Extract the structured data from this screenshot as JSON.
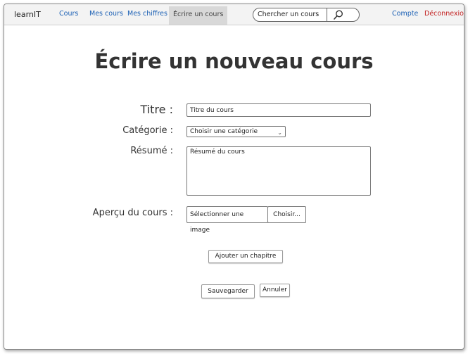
{
  "app": {
    "logo": "learnIT"
  },
  "nav": {
    "items": [
      {
        "label": "Cours"
      },
      {
        "label": "Mes cours"
      },
      {
        "label": "Mes chiffres"
      },
      {
        "label": "Écrire un cours"
      }
    ],
    "active_index": 3
  },
  "search": {
    "value": "Chercher un cours",
    "icon": "search-icon"
  },
  "user_links": {
    "account": "Compte",
    "logout": "Déconnexion"
  },
  "page": {
    "title": "Écrire un nouveau cours"
  },
  "form": {
    "title_label": "Titre :",
    "title_value": "Titre du cours",
    "category_label": "Catégorie :",
    "category_value": "Choisir une catégorie",
    "summary_label": "Résumé :",
    "summary_value": "Résumé du cours",
    "preview_label": "Aperçu du cours :",
    "preview_value": "Sélectionner une image",
    "browse_label": "Choisir...",
    "add_chapter_label": "Ajouter un chapitre",
    "save_label": "Sauvegarder",
    "cancel_label": "Annuler"
  },
  "colors": {
    "link": "#1a5fb4",
    "logout": "#c21e1e",
    "active_tab_bg": "#d8d8d8"
  }
}
